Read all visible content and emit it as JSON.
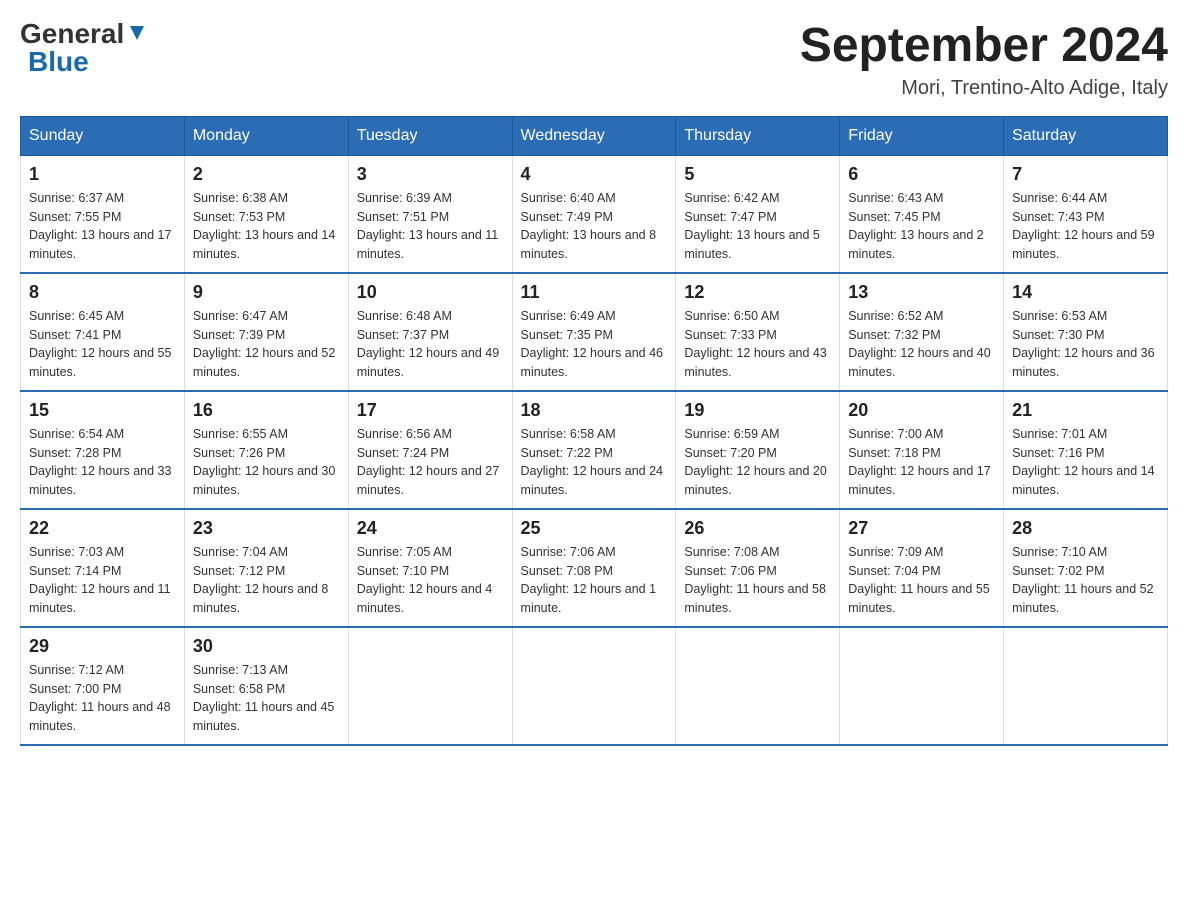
{
  "header": {
    "logo_general": "General",
    "logo_blue": "Blue",
    "month_title": "September 2024",
    "location": "Mori, Trentino-Alto Adige, Italy"
  },
  "days_of_week": [
    "Sunday",
    "Monday",
    "Tuesday",
    "Wednesday",
    "Thursday",
    "Friday",
    "Saturday"
  ],
  "weeks": [
    [
      {
        "date": "1",
        "sunrise": "6:37 AM",
        "sunset": "7:55 PM",
        "daylight": "13 hours and 17 minutes."
      },
      {
        "date": "2",
        "sunrise": "6:38 AM",
        "sunset": "7:53 PM",
        "daylight": "13 hours and 14 minutes."
      },
      {
        "date": "3",
        "sunrise": "6:39 AM",
        "sunset": "7:51 PM",
        "daylight": "13 hours and 11 minutes."
      },
      {
        "date": "4",
        "sunrise": "6:40 AM",
        "sunset": "7:49 PM",
        "daylight": "13 hours and 8 minutes."
      },
      {
        "date": "5",
        "sunrise": "6:42 AM",
        "sunset": "7:47 PM",
        "daylight": "13 hours and 5 minutes."
      },
      {
        "date": "6",
        "sunrise": "6:43 AM",
        "sunset": "7:45 PM",
        "daylight": "13 hours and 2 minutes."
      },
      {
        "date": "7",
        "sunrise": "6:44 AM",
        "sunset": "7:43 PM",
        "daylight": "12 hours and 59 minutes."
      }
    ],
    [
      {
        "date": "8",
        "sunrise": "6:45 AM",
        "sunset": "7:41 PM",
        "daylight": "12 hours and 55 minutes."
      },
      {
        "date": "9",
        "sunrise": "6:47 AM",
        "sunset": "7:39 PM",
        "daylight": "12 hours and 52 minutes."
      },
      {
        "date": "10",
        "sunrise": "6:48 AM",
        "sunset": "7:37 PM",
        "daylight": "12 hours and 49 minutes."
      },
      {
        "date": "11",
        "sunrise": "6:49 AM",
        "sunset": "7:35 PM",
        "daylight": "12 hours and 46 minutes."
      },
      {
        "date": "12",
        "sunrise": "6:50 AM",
        "sunset": "7:33 PM",
        "daylight": "12 hours and 43 minutes."
      },
      {
        "date": "13",
        "sunrise": "6:52 AM",
        "sunset": "7:32 PM",
        "daylight": "12 hours and 40 minutes."
      },
      {
        "date": "14",
        "sunrise": "6:53 AM",
        "sunset": "7:30 PM",
        "daylight": "12 hours and 36 minutes."
      }
    ],
    [
      {
        "date": "15",
        "sunrise": "6:54 AM",
        "sunset": "7:28 PM",
        "daylight": "12 hours and 33 minutes."
      },
      {
        "date": "16",
        "sunrise": "6:55 AM",
        "sunset": "7:26 PM",
        "daylight": "12 hours and 30 minutes."
      },
      {
        "date": "17",
        "sunrise": "6:56 AM",
        "sunset": "7:24 PM",
        "daylight": "12 hours and 27 minutes."
      },
      {
        "date": "18",
        "sunrise": "6:58 AM",
        "sunset": "7:22 PM",
        "daylight": "12 hours and 24 minutes."
      },
      {
        "date": "19",
        "sunrise": "6:59 AM",
        "sunset": "7:20 PM",
        "daylight": "12 hours and 20 minutes."
      },
      {
        "date": "20",
        "sunrise": "7:00 AM",
        "sunset": "7:18 PM",
        "daylight": "12 hours and 17 minutes."
      },
      {
        "date": "21",
        "sunrise": "7:01 AM",
        "sunset": "7:16 PM",
        "daylight": "12 hours and 14 minutes."
      }
    ],
    [
      {
        "date": "22",
        "sunrise": "7:03 AM",
        "sunset": "7:14 PM",
        "daylight": "12 hours and 11 minutes."
      },
      {
        "date": "23",
        "sunrise": "7:04 AM",
        "sunset": "7:12 PM",
        "daylight": "12 hours and 8 minutes."
      },
      {
        "date": "24",
        "sunrise": "7:05 AM",
        "sunset": "7:10 PM",
        "daylight": "12 hours and 4 minutes."
      },
      {
        "date": "25",
        "sunrise": "7:06 AM",
        "sunset": "7:08 PM",
        "daylight": "12 hours and 1 minute."
      },
      {
        "date": "26",
        "sunrise": "7:08 AM",
        "sunset": "7:06 PM",
        "daylight": "11 hours and 58 minutes."
      },
      {
        "date": "27",
        "sunrise": "7:09 AM",
        "sunset": "7:04 PM",
        "daylight": "11 hours and 55 minutes."
      },
      {
        "date": "28",
        "sunrise": "7:10 AM",
        "sunset": "7:02 PM",
        "daylight": "11 hours and 52 minutes."
      }
    ],
    [
      {
        "date": "29",
        "sunrise": "7:12 AM",
        "sunset": "7:00 PM",
        "daylight": "11 hours and 48 minutes."
      },
      {
        "date": "30",
        "sunrise": "7:13 AM",
        "sunset": "6:58 PM",
        "daylight": "11 hours and 45 minutes."
      },
      null,
      null,
      null,
      null,
      null
    ]
  ]
}
